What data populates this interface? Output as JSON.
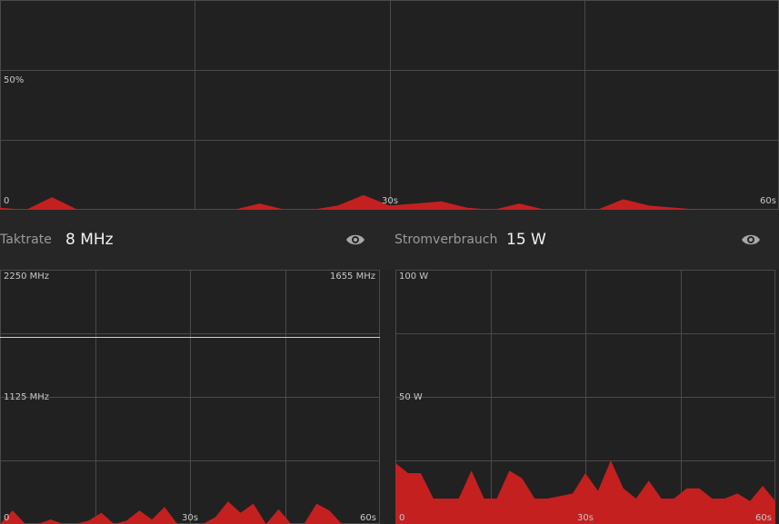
{
  "top_graph": {
    "ymid_label": "50%",
    "zero_label": "0",
    "x_mid_label": "30s",
    "x_end_label": "60s",
    "fill_color": "#c42020",
    "grid_color": "#4a4a4a"
  },
  "clock": {
    "label": "Taktrate",
    "value": "8 MHz",
    "eye_icon": "eye-icon",
    "graph": {
      "ymax_label": "2250 MHz",
      "ymid_label": "1125 MHz",
      "zero_label": "0",
      "peak_label": "1655 MHz",
      "x_mid_label": "30s",
      "x_end_label": "60s"
    }
  },
  "power": {
    "label": "Stromverbrauch",
    "value": "15 W",
    "eye_icon": "eye-icon",
    "graph": {
      "ymax_label": "100 W",
      "ymid_label": "50 W",
      "zero_label": "0",
      "x_mid_label": "30s",
      "x_end_label": "60s"
    }
  },
  "chart_data": [
    {
      "type": "area",
      "ylim": [
        0,
        100
      ],
      "x": [
        0,
        2,
        4,
        6,
        8,
        10,
        12,
        14,
        16,
        18,
        20,
        22,
        24,
        26,
        28,
        30,
        32,
        34,
        36,
        38,
        40,
        42,
        44,
        46,
        48,
        50,
        52,
        54,
        56,
        58,
        60
      ],
      "values": [
        1,
        0,
        6,
        0,
        0,
        0,
        0,
        0,
        0,
        0,
        3,
        0,
        0,
        2,
        7,
        2,
        3,
        4,
        1,
        0,
        3,
        0,
        0,
        0,
        5,
        2,
        1,
        0,
        0,
        0,
        0
      ],
      "zero_label": "0",
      "tick_labels": [
        "50%",
        "30s",
        "60s"
      ]
    },
    {
      "type": "area",
      "ylim": [
        0,
        2250
      ],
      "ylabels": [
        "2250 MHz",
        "1125 MHz",
        "0"
      ],
      "reference_line_value": 1655,
      "reference_line_label": "1655 MHz",
      "x": [
        0,
        2,
        4,
        6,
        8,
        10,
        12,
        14,
        16,
        18,
        20,
        22,
        24,
        26,
        28,
        30,
        32,
        34,
        36,
        38,
        40,
        42,
        44,
        46,
        48,
        50,
        52,
        54,
        56,
        58,
        60
      ],
      "values": [
        0,
        120,
        0,
        0,
        40,
        0,
        0,
        30,
        100,
        0,
        30,
        120,
        40,
        150,
        0,
        0,
        0,
        60,
        200,
        100,
        180,
        0,
        130,
        0,
        0,
        180,
        120,
        0,
        0,
        0,
        0
      ],
      "tick_labels": [
        "30s",
        "60s"
      ]
    },
    {
      "type": "area",
      "ylim": [
        0,
        100
      ],
      "ylabels": [
        "100 W",
        "50 W",
        "0"
      ],
      "x": [
        0,
        2,
        4,
        6,
        8,
        10,
        12,
        14,
        16,
        18,
        20,
        22,
        24,
        26,
        28,
        30,
        32,
        34,
        36,
        38,
        40,
        42,
        44,
        46,
        48,
        50,
        52,
        54,
        56,
        58,
        60
      ],
      "values": [
        24,
        20,
        20,
        10,
        10,
        10,
        21,
        10,
        10,
        21,
        18,
        10,
        10,
        11,
        12,
        20,
        13,
        25,
        14,
        10,
        17,
        10,
        10,
        14,
        14,
        10,
        10,
        12,
        9,
        15,
        9
      ],
      "tick_labels": [
        "30s",
        "60s"
      ]
    }
  ]
}
